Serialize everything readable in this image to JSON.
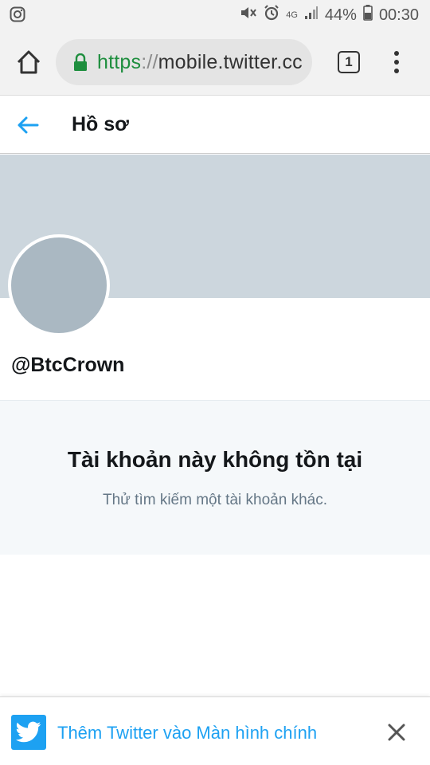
{
  "status_bar": {
    "battery": "44%",
    "time": "00:30",
    "network": "4G",
    "icons": [
      "instagram-icon",
      "mute-icon",
      "alarm-icon",
      "signal-icon",
      "battery-icon"
    ]
  },
  "browser": {
    "url_scheme": "https",
    "url_separator": "://",
    "url_host": "mobile.twitter.cc",
    "tab_count": "1"
  },
  "header": {
    "title": "Hồ sơ"
  },
  "profile": {
    "handle": "@BtcCrown"
  },
  "empty_state": {
    "title": "Tài khoản này không tồn tại",
    "subtitle": "Thử tìm kiếm một tài khoản khác."
  },
  "promo": {
    "label": "Thêm Twitter vào Màn hình chính"
  },
  "colors": {
    "accent": "#1da1f2",
    "banner": "#ccd6dd",
    "avatar": "#aab8c2",
    "secure": "#1e8e3e",
    "empty_bg": "#f5f8fa"
  }
}
